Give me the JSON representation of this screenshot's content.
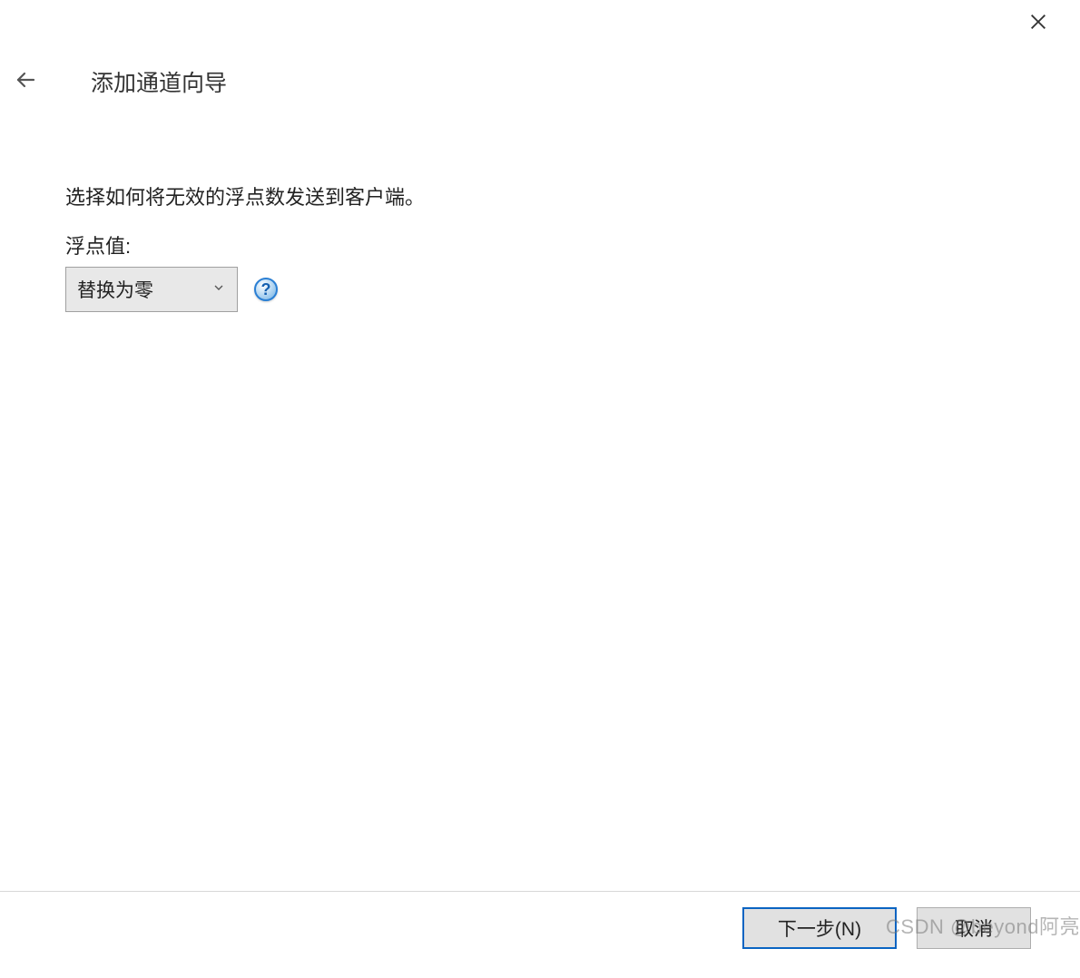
{
  "window": {
    "title": "添加通道向导"
  },
  "content": {
    "description": "选择如何将无效的浮点数发送到客户端。",
    "float_label": "浮点值:",
    "float_selected": "替换为零",
    "help_symbol": "?"
  },
  "footer": {
    "next_label": "下一步(N)",
    "cancel_label": "取消"
  },
  "watermark": "CSDN @beyond阿亮"
}
